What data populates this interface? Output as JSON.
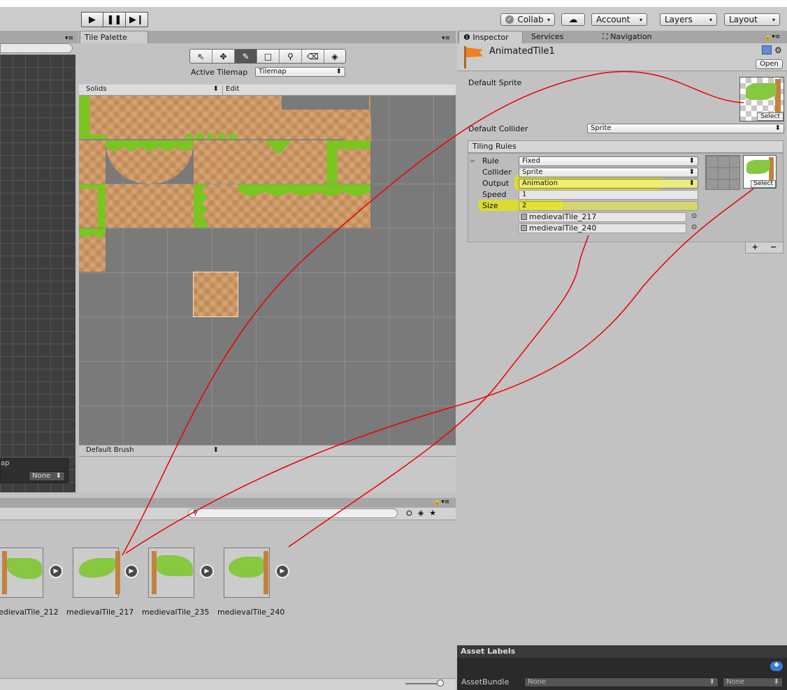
{
  "toolbar": {
    "collab": "Collab",
    "account": "Account",
    "layers": "Layers",
    "layout": "Layout"
  },
  "left_panel": {
    "map_label": "ap",
    "none_dd": "None"
  },
  "palette": {
    "tab": "Tile Palette",
    "active_tilemap_label": "Active Tilemap",
    "active_tilemap_value": "Tilemap",
    "palette_dd": "Solids",
    "edit": "Edit",
    "brush_dd": "Default Brush"
  },
  "inspector": {
    "tabs": [
      "Inspector",
      "Services",
      "Navigation"
    ],
    "asset_name": "AnimatedTile1",
    "open": "Open",
    "default_sprite_label": "Default Sprite",
    "select": "Select",
    "default_collider_label": "Default Collider",
    "default_collider_value": "Sprite",
    "tiling_rules": "Tiling Rules",
    "rule_label": "Rule",
    "rule_value": "Fixed",
    "collider_label": "Collider",
    "collider_value": "Sprite",
    "output_label": "Output",
    "output_value": "Animation",
    "speed_label": "Speed",
    "speed_value": "1",
    "size_label": "Size",
    "size_value": "2",
    "sprites": [
      "medievalTile_217",
      "medievalTile_240"
    ],
    "asset_labels": "Asset Labels",
    "asset_bundle_label": "AssetBundle",
    "asset_bundle_value": "None",
    "asset_bundle_variant": "None"
  },
  "project": {
    "items": [
      "edievalTile_212",
      "medievalTile_217",
      "medievalTile_235",
      "medievalTile_240"
    ]
  },
  "colors": {
    "accent_highlight": "#e6e600",
    "annotation_line": "#ee0000",
    "tile_orange": "#cf9660",
    "grass": "#7bc521"
  }
}
